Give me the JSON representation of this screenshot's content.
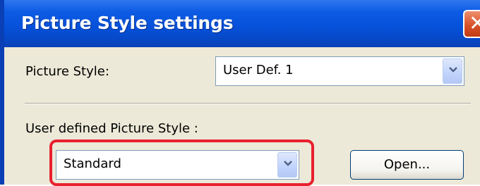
{
  "window": {
    "title": "Picture Style settings",
    "close_glyph": "✕",
    "close_icon": "close-icon"
  },
  "picture_style": {
    "label": "Picture Style:",
    "selected": "User Def. 1"
  },
  "user_defined": {
    "label": "User defined Picture Style :",
    "selected": "Standard",
    "open_button_label": "Open...",
    "highlight_color": "#e8202f"
  },
  "colors": {
    "titlebar": "#0650d8",
    "dialog_bg": "#ece9d8",
    "close_button": "#d9532a"
  }
}
